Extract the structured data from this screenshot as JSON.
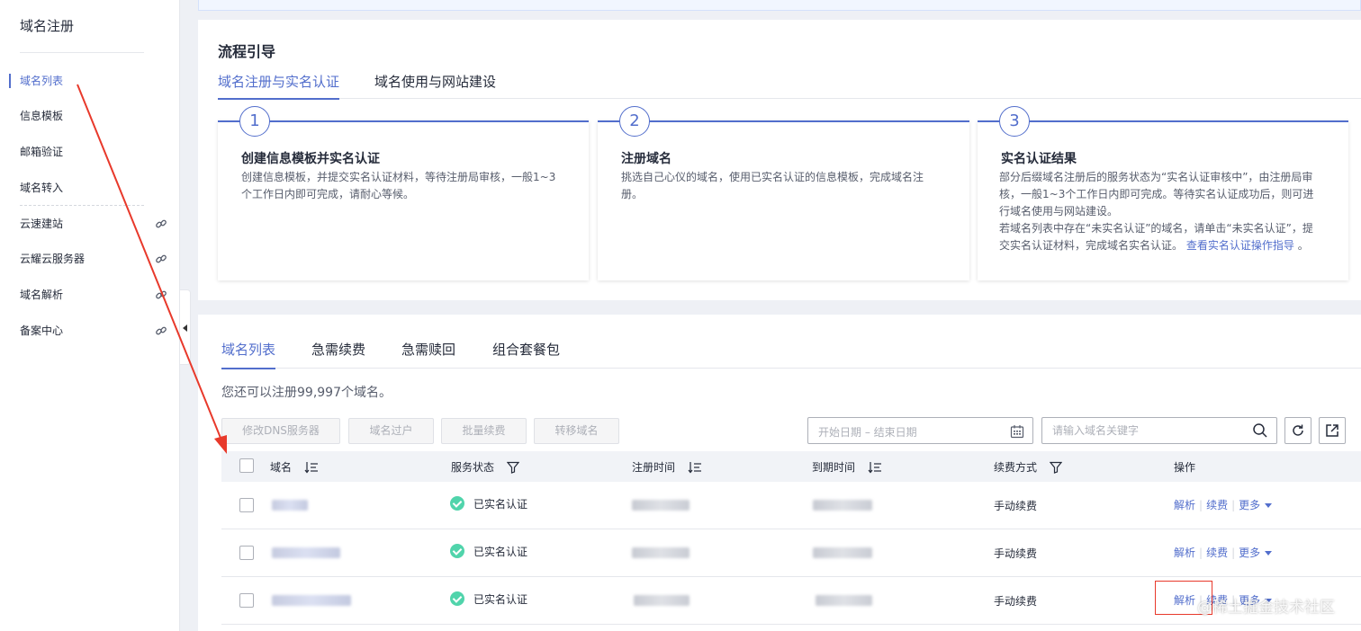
{
  "sidebar": {
    "title": "域名注册",
    "items": [
      {
        "label": "域名列表",
        "external": false
      },
      {
        "label": "信息模板",
        "external": false
      },
      {
        "label": "邮箱验证",
        "external": false
      },
      {
        "label": "域名转入",
        "external": false
      },
      {
        "label": "云速建站",
        "external": true
      },
      {
        "label": "云耀云服务器",
        "external": true
      },
      {
        "label": "域名解析",
        "external": true
      },
      {
        "label": "备案中心",
        "external": true
      }
    ]
  },
  "guide": {
    "title": "流程引导",
    "tabs": [
      "域名注册与实名认证",
      "域名使用与网站建设"
    ],
    "steps": [
      {
        "num": "1",
        "title": "创建信息模板并实名认证",
        "desc_lines": [
          "创建信息模板，并提交实名认证材料，等待注册局审核，一般1~3",
          "个工作日内即可完成，请耐心等候。"
        ]
      },
      {
        "num": "2",
        "title": "注册域名",
        "desc_lines": [
          "挑选自己心仪的域名，使用已实名认证的信息模板，完成域名注",
          "册。"
        ]
      },
      {
        "num": "3",
        "title": "实名认证结果",
        "desc_lines": [
          "部分后缀域名注册后的服务状态为“实名认证审核中”，由注册局审",
          "核，一般1~3个工作日内即可完成。等待实名认证成功后，则可进",
          "行域名使用与网站建设。",
          "若域名列表中存在“未实名认证”的域名，请单击“未实名认证”，提"
        ],
        "last_line_prefix": "交实名认证材料，完成域名实名认证。",
        "link": "查看实名认证操作指导",
        "last_line_suffix": "。"
      }
    ]
  },
  "list": {
    "tabs": [
      "域名列表",
      "急需续费",
      "急需赎回",
      "组合套餐包"
    ],
    "quota_text": "您还可以注册99,997个域名。",
    "toolbar": {
      "buttons": [
        "修改DNS服务器",
        "域名过户",
        "批量续费",
        "转移域名"
      ],
      "date_placeholder": "开始日期 – 结束日期",
      "search_placeholder": "请输入域名关键字"
    },
    "columns": [
      "域名",
      "服务状态",
      "注册时间",
      "到期时间",
      "续费方式",
      "操作"
    ],
    "rows": [
      {
        "status": "已实名认证",
        "renew": "手动续费",
        "ops": [
          "解析",
          "续费",
          "更多"
        ]
      },
      {
        "status": "已实名认证",
        "renew": "手动续费",
        "ops": [
          "解析",
          "续费",
          "更多"
        ]
      },
      {
        "status": "已实名认证",
        "renew": "手动续费",
        "ops": [
          "解析",
          "续费",
          "更多"
        ]
      }
    ]
  },
  "watermark": "@稀土掘金技术社区",
  "colors": {
    "accent": "#526ecc",
    "success": "#50d4ab",
    "annotation": "#e8392b"
  },
  "icons": [
    "link-icon",
    "calendar-icon",
    "search-icon",
    "refresh-icon",
    "export-icon",
    "sort-icon",
    "filter-icon",
    "check-circle-icon",
    "chevron-down-icon"
  ]
}
